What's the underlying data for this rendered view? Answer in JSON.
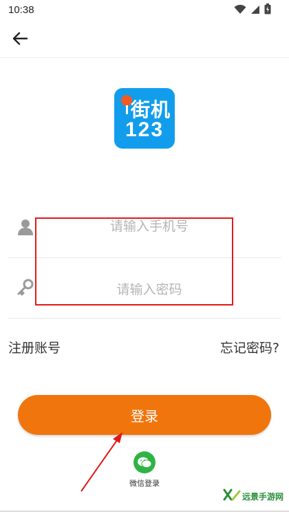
{
  "status_bar": {
    "time": "10:38",
    "icons": [
      "wifi-icon",
      "signal-icon",
      "battery-icon"
    ]
  },
  "header": {
    "back_icon": "arrow-left-icon"
  },
  "app_logo": {
    "line1": "街机",
    "line2": "123",
    "background_color": "#129dec"
  },
  "form": {
    "phone_placeholder": "请输入手机号",
    "password_placeholder": "请输入密码",
    "phone_icon": "user-icon",
    "password_icon": "key-icon"
  },
  "links": {
    "register": "注册账号",
    "forgot_password": "忘记密码?"
  },
  "login_button": {
    "label": "登录",
    "color": "#f1750d"
  },
  "wechat_login": {
    "label": "微信登录",
    "icon": "wechat-icon",
    "color": "#2fb344"
  },
  "annotation": {
    "highlight_color": "#e01818"
  },
  "watermark": {
    "text": "远景手游网"
  }
}
